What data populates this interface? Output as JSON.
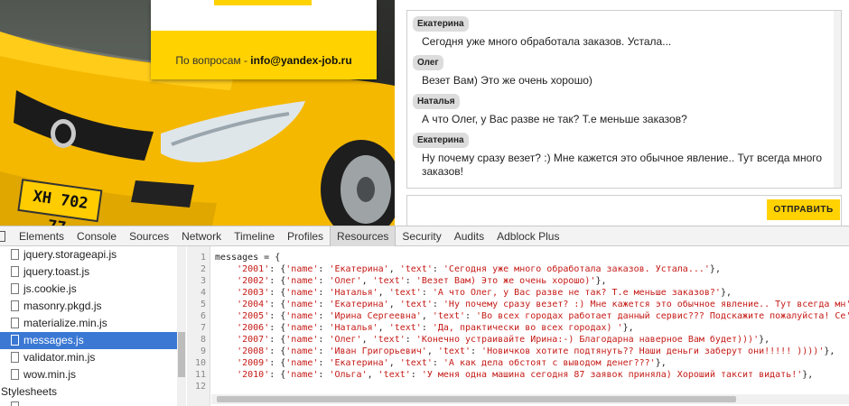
{
  "promo": {
    "contact_prefix": "По вопросам - ",
    "contact_email": "info@yandex-job.ru"
  },
  "car": {
    "plate": "ХН 702 77"
  },
  "chat": {
    "messages": [
      {
        "name": "Екатерина",
        "text": "Сегодня уже много обработала заказов. Устала..."
      },
      {
        "name": "Олег",
        "text": "Везет Вам) Это же очень хорошо)"
      },
      {
        "name": "Наталья",
        "text": "А что Олег, у Вас разве не так? Т.е меньше заказов?"
      },
      {
        "name": "Екатерина",
        "text": "Ну почему сразу везет? :) Мне кажется это обычное явление.. Тут всегда много заказов!"
      }
    ],
    "send_label": "ОТПРАВИТЬ"
  },
  "devtools": {
    "tabs": [
      "Elements",
      "Console",
      "Sources",
      "Network",
      "Timeline",
      "Profiles",
      "Resources",
      "Security",
      "Audits",
      "Adblock Plus"
    ],
    "active_tab": "Resources",
    "files": [
      "jquery.storageapi.js",
      "jquery.toast.js",
      "js.cookie.js",
      "masonry.pkgd.js",
      "materialize.min.js",
      "messages.js",
      "validator.min.js",
      "wow.min.js"
    ],
    "selected_file": "messages.js",
    "section_label": "Stylesheets",
    "line_numbers": [
      "1",
      "2",
      "3",
      "4",
      "5",
      "6",
      "7",
      "8",
      "9",
      "10",
      "11",
      "12"
    ],
    "code_first_line": "messages = {",
    "code_lines": [
      {
        "id": "2001",
        "name": "Екатерина",
        "text": "Сегодня уже много обработала заказов. Устала..."
      },
      {
        "id": "2002",
        "name": "Олег",
        "text": "Везет Вам) Это же очень хорошо)"
      },
      {
        "id": "2003",
        "name": "Наталья",
        "text": "А что Олег, у Вас разве не так? Т.е меньше заказов?"
      },
      {
        "id": "2004",
        "name": "Екатерина",
        "text": "Ну почему сразу везет? :) Мне кажется это обычное явление.. Тут всегда мн"
      },
      {
        "id": "2005",
        "name": "Ирина Сергеевна",
        "text": "Во всех городах работает данный сервис??? Подскажите пожалуйста! Се"
      },
      {
        "id": "2006",
        "name": "Наталья",
        "text": "Да, практически во всех городах) "
      },
      {
        "id": "2007",
        "name": "Олег",
        "text": "Конечно устраивайте Ирина:-) Благодарна наверное Вам будет)))"
      },
      {
        "id": "2008",
        "name": "Иван Григорьевич",
        "text": "Новичков хотите подтянуть?? Наши деньги заберут они!!!!! ))))"
      },
      {
        "id": "2009",
        "name": "Екатерина",
        "text": "А как дела обстоят с выводом денег???"
      },
      {
        "id": "2010",
        "name": "Ольга",
        "text": "У меня одна машина сегодня 87 заявок приняла) Хороший таксит видать!"
      }
    ]
  },
  "colors": {
    "accent_yellow": "#ffd200",
    "selection_blue": "#3a78d4",
    "string_red": "#c41a16"
  }
}
